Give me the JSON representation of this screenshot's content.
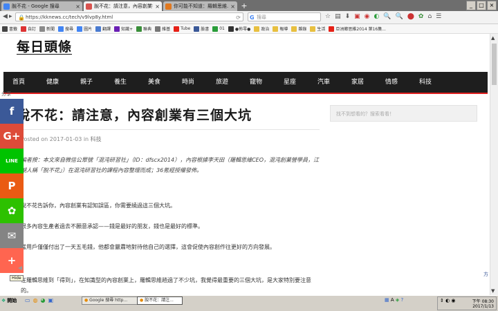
{
  "browser": {
    "tabs": [
      {
        "label": "脫不花 - Google 搜尋",
        "color": "#4285f4",
        "active": false
      },
      {
        "label": "脫不花：請注意，內容創業有...",
        "color": "#d9534f",
        "active": true
      },
      {
        "label": "你可能不知道：羅輯思維...",
        "color": "#e0781f",
        "active": false
      }
    ],
    "close_glyph": "×",
    "new_tab_glyph": "+",
    "url": "https://kknews.cc/tech/v9lvp8y.html",
    "search_placeholder": "搜尋",
    "search_logo": "G",
    "window_buttons": [
      "_",
      "□",
      "×"
    ]
  },
  "bookmarks": [
    {
      "label": "書籤",
      "color": "#444"
    },
    {
      "label": "自訂",
      "color": "#d33"
    },
    {
      "label": "新聞",
      "color": "#8a8a8a"
    },
    {
      "label": "搜尋",
      "color": "#4285f4"
    },
    {
      "label": "圖片",
      "color": "#4285f4"
    },
    {
      "label": "翻譯",
      "color": "#4a7bd0"
    },
    {
      "label": "知識+",
      "color": "#6a1fb4"
    },
    {
      "label": "聯典",
      "color": "#3a8f3a"
    },
    {
      "label": "維基",
      "color": "#777"
    },
    {
      "label": "Tube",
      "color": "#e62117"
    },
    {
      "label": "臉書",
      "color": "#3b5998"
    },
    {
      "label": "01",
      "color": "#2a9d3a"
    },
    {
      "label": "●佈零●",
      "color": "#333"
    },
    {
      "label": "政治",
      "color": "#e8c040"
    },
    {
      "label": "報導",
      "color": "#e8c040"
    },
    {
      "label": "雜錄",
      "color": "#e8c040"
    },
    {
      "label": "生活",
      "color": "#e8c040"
    },
    {
      "label": "亞洲鄉思維2014 第16集...",
      "color": "#e62117"
    }
  ],
  "site": {
    "logo": "每日頭條",
    "nav": [
      "首頁",
      "健康",
      "親子",
      "養生",
      "美食",
      "時尚",
      "旅遊",
      "寵物",
      "星座",
      "汽車",
      "家居",
      "情感",
      "科技"
    ],
    "corner_label": "分享",
    "side_search_placeholder": "找不到想看的？搜索看看！"
  },
  "article": {
    "title": "脫不花：請注意，內容創業有三個大坑",
    "posted_prefix": "Posted on 2017-01-03 in",
    "category": "科技",
    "paragraphs": [
      "編者按：本文來自微信公眾號「混沌研習社」（ID：dfscx2014），內容根據李天田（羅輯思維CEO，混沌創業營學員，江湖人稱「脫不花」）在混沌研習社的課程內容整理而成；36氪經授權發佈。",
      "脫不花告訴你，內容創業有認知誤區，你需要繞過這三個大坑。",
      "很多內容生產者過去不願意承認——錢是最好的朋友，錢也是最好的標準。",
      "當用戶僅僅付出了一天五毛錢，他都會嚴肅地對待他自己的選擇，這會促使內容創作往更好的方向發展。",
      "在羅輯思維到「得到」，在知識型的內容創業上，羅輯思維趟過了不少坑，我覺得最重要的三個大坑，是大家特別要注意的。"
    ]
  },
  "social": [
    {
      "name": "facebook-share-button",
      "glyph": "f",
      "color": "#3b5998"
    },
    {
      "name": "google-plus-share-button",
      "glyph": "G+",
      "color": "#dd4b39"
    },
    {
      "name": "line-share-button",
      "glyph": "LINE",
      "color": "#00c300"
    },
    {
      "name": "pinterest-share-button",
      "glyph": "P",
      "color": "#ea5b13"
    },
    {
      "name": "wechat-share-button",
      "glyph": "✿",
      "color": "#2dc100"
    },
    {
      "name": "email-share-button",
      "glyph": "✉",
      "color": "#848484"
    },
    {
      "name": "more-share-button",
      "glyph": "+",
      "color": "#ff6550"
    }
  ],
  "social_hide_label": "Hide",
  "taskbar": {
    "start": "開始",
    "tasks": [
      {
        "label": "Google 搜尋 http...",
        "active": false
      },
      {
        "label": "脫不花：請注...",
        "active": true
      }
    ],
    "time": "下午 08:30",
    "date": "2017/1/13"
  },
  "side_peek_text": "方"
}
